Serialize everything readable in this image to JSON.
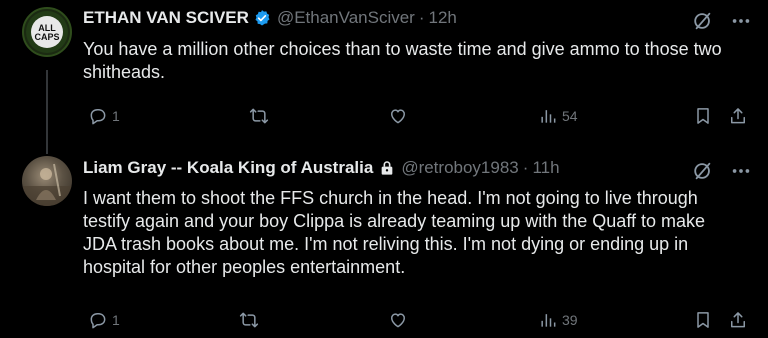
{
  "tweets": [
    {
      "author": "ETHAN VAN SCIVER",
      "handle": "@EthanVanSciver",
      "separator": "·",
      "time": "12h",
      "avatar_text": "ALL CAPS",
      "verified": true,
      "text": "You have a million other choices than to waste time and give ammo to those two shitheads.",
      "stats": {
        "replies": "1",
        "retweets": "",
        "likes": "",
        "views": "54"
      }
    },
    {
      "author": "Liam Gray -- Koala King of Australia",
      "handle": "@retroboy1983",
      "separator": "·",
      "time": "11h",
      "locked": true,
      "text": "I want them to shoot the FFS church in the head. I'm not going to live through testify again and your boy Clippa is already teaming up with the Quaff to make JDA trash books about me. I'm not reliving this. I'm not dying or ending up in hospital for other peoples entertainment.",
      "stats": {
        "replies": "1",
        "retweets": "",
        "likes": "",
        "views": "39"
      }
    }
  ],
  "colors": {
    "background": "#000000",
    "text": "#e7e9ea",
    "muted": "#71767b",
    "verified": "#1d9bf0"
  }
}
